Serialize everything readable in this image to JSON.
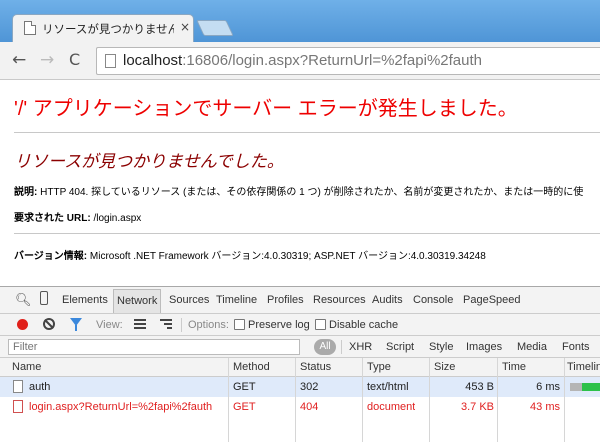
{
  "browser": {
    "tab_title": "リソースが見つかりませんでした",
    "tab_close": "×",
    "nav_back": "←",
    "nav_forward": "→",
    "nav_reload": "C",
    "url_host": "localhost",
    "url_rest": ":16806/login.aspx?ReturnUrl=%2fapi%2fauth"
  },
  "page": {
    "heading": "'/' アプリケーションでサーバー エラーが発生しました。",
    "subheading": "リソースが見つかりませんでした。",
    "description_label": "説明:",
    "description_text": "HTTP 404. 探しているリソース (または、その依存関係の 1 つ) が削除されたか、名前が変更されたか、または一時的に使",
    "url_label": "要求された URL:",
    "url_value": "/login.aspx",
    "version_label": "バージョン情報:",
    "version_value": "Microsoft .NET Framework バージョン:4.0.30319; ASP.NET バージョン:4.0.30319.34248"
  },
  "devtools": {
    "tabs": [
      "Elements",
      "Network",
      "Sources",
      "Timeline",
      "Profiles",
      "Resources",
      "Audits",
      "Console",
      "PageSpeed"
    ],
    "active_tab": "Network",
    "toolbar": {
      "view_label": "View:",
      "options_label": "Options:",
      "preserve_log": "Preserve log",
      "disable_cache": "Disable cache"
    },
    "filter_placeholder": "Filter",
    "type_filters": [
      "All",
      "XHR",
      "Script",
      "Style",
      "Images",
      "Media",
      "Fonts"
    ],
    "columns": [
      "Name",
      "Method",
      "Status",
      "Type",
      "Size",
      "Time",
      "Timeline"
    ],
    "rows": [
      {
        "name": "auth",
        "method": "GET",
        "status": "302",
        "type": "text/html",
        "size": "453 B",
        "time": "6 ms"
      },
      {
        "name": "login.aspx?ReturnUrl=%2fapi%2fauth",
        "method": "GET",
        "status": "404",
        "type": "document",
        "size": "3.7 KB",
        "time": "43 ms"
      }
    ],
    "colors": {
      "record": "#e0201a",
      "filter": "#3b88dc",
      "error_row": "#e02020",
      "selected_row": "#dfeafa",
      "timeline_wait": "#b5b5b5",
      "timeline_receive": "#2cc14a"
    }
  }
}
